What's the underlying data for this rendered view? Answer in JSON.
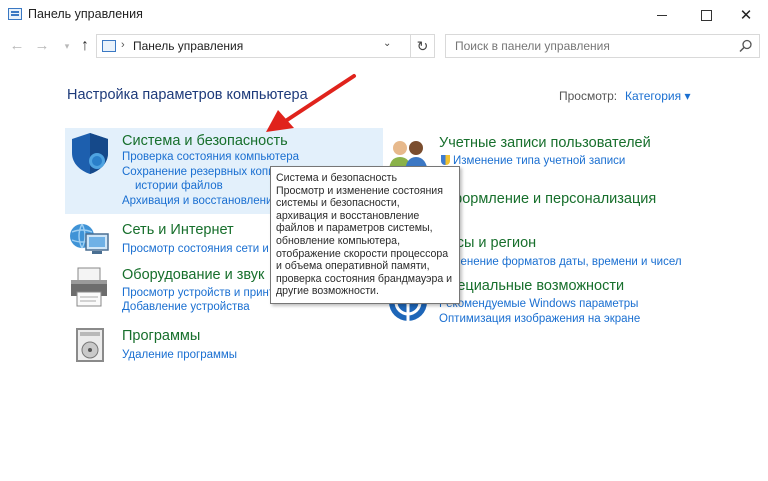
{
  "window": {
    "title": "Панель управления"
  },
  "address": {
    "path": "Панель управления",
    "separator": "›"
  },
  "search": {
    "placeholder": "Поиск в панели управления"
  },
  "page": {
    "heading": "Настройка параметров компьютера",
    "view_label": "Просмотр:",
    "view_value": "Категория",
    "view_arrow": "▾"
  },
  "categories": [
    {
      "title": "Система и безопасность",
      "links": [
        "Проверка состояния компьютера",
        "Сохранение резервных копий",
        "истории файлов",
        "Архивация и восстановление"
      ],
      "icon": "shield-icon"
    },
    {
      "title": "Сеть и Интернет",
      "links": [
        "Просмотр состояния сети и задач"
      ],
      "icon": "network-icon"
    },
    {
      "title": "Оборудование и звук",
      "links": [
        "Просмотр устройств и принтеров",
        "Добавление устройства"
      ],
      "icon": "printer-icon"
    },
    {
      "title": "Программы",
      "links": [
        "Удаление программы"
      ],
      "icon": "programs-icon"
    },
    {
      "title": "Учетные записи пользователей",
      "links": [
        "Изменение типа учетной записи"
      ],
      "icon": "users-icon"
    },
    {
      "title": "Оформление и персонализация",
      "links": [],
      "icon": "appearance-icon"
    },
    {
      "title": "Часы и регион",
      "links": [
        "Изменение форматов даты, времени и чисел"
      ],
      "icon": "clock-icon"
    },
    {
      "title": "Специальные возможности",
      "links": [
        "Рекомендуемые Windows параметры",
        "Оптимизация изображения на экране"
      ],
      "icon": "accessibility-icon"
    }
  ],
  "tooltip": {
    "lines": [
      "Система и безопасность",
      "Просмотр и изменение состояния",
      "системы и безопасности,",
      "архивация и восстановление",
      "файлов и параметров системы,",
      "обновление компьютера,",
      "отображение скорости процессора",
      "и объема оперативной памяти,",
      "проверка состояния брандмауэра и",
      "другие возможности."
    ]
  },
  "colors": {
    "category_title": "#176f2c",
    "link": "#1a6fd1",
    "heading": "#1d3a7a",
    "highlight": "#e3f0fb",
    "annotation_arrow": "#e0231c"
  }
}
